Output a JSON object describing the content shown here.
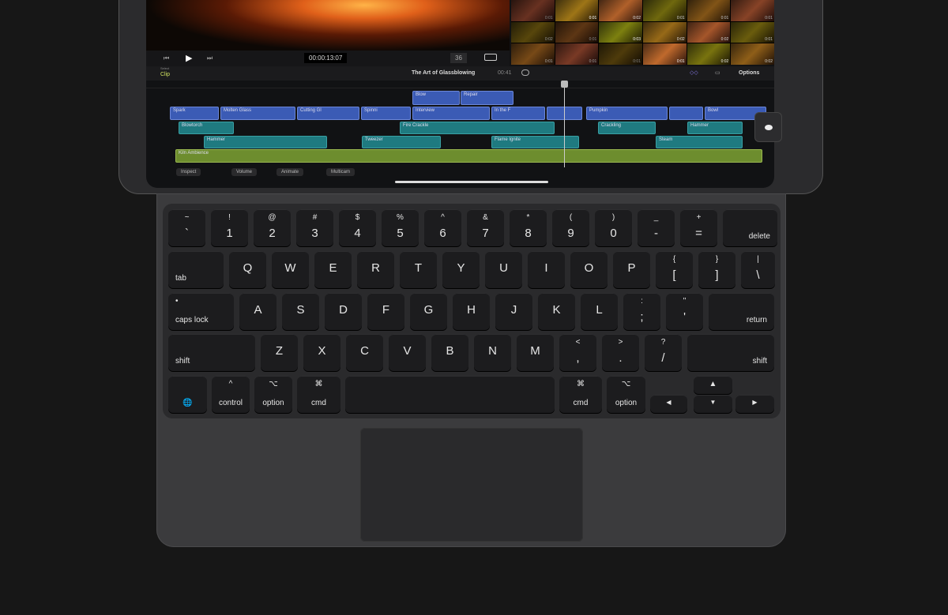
{
  "fcp": {
    "viewer": {
      "skip_back": "⏮",
      "play": "▶",
      "skip_fwd": "⏭",
      "timecode": "00:00:13:07",
      "zoom": "36"
    },
    "browser": {
      "durations": [
        "0:01",
        "0:01",
        "0:02",
        "0:01",
        "0:01",
        "0:01",
        "0:02",
        "0:01",
        "0:03",
        "0:02",
        "0:02",
        "0:01",
        "0:01",
        "0:01",
        "0:01",
        "0:01",
        "0:02",
        "0:02"
      ]
    },
    "header": {
      "select_label": "Select",
      "mode": "Clip",
      "project_title": "The Art of Glassblowing",
      "duration": "00:41",
      "options": "Options"
    },
    "clips": {
      "connected_video": [
        "Blow",
        "Repair"
      ],
      "primary": [
        "Spark",
        "Molten Glass",
        "Cutting Gl",
        "Spinni",
        "Interview",
        "In the F",
        "",
        "Pumpkin",
        "",
        "Bowl"
      ],
      "audio1": [
        "Blowtorch",
        "Fire Crackle",
        "Crackling",
        "Hammer"
      ],
      "audio2": [
        "Hammer",
        "Tweezer",
        "Flame Ignite",
        "Steam"
      ],
      "music": "Kiln Ambience"
    },
    "toolbar": [
      "Inspect",
      "Volume",
      "Animate",
      "Multicam"
    ]
  },
  "keyboard": {
    "rows": [
      [
        [
          "~",
          "`"
        ],
        [
          "!",
          "1"
        ],
        [
          "@",
          "2"
        ],
        [
          "#",
          "3"
        ],
        [
          "$",
          "4"
        ],
        [
          "%",
          "5"
        ],
        [
          "^",
          "6"
        ],
        [
          "&",
          "7"
        ],
        [
          "*",
          "8"
        ],
        [
          "(",
          "9"
        ],
        [
          ")",
          "0"
        ],
        [
          "_",
          "-"
        ],
        [
          "+",
          "="
        ],
        [
          "",
          "delete"
        ]
      ],
      [
        [
          "",
          "tab"
        ],
        [
          "Q"
        ],
        [
          "W"
        ],
        [
          "E"
        ],
        [
          "R"
        ],
        [
          "T"
        ],
        [
          "Y"
        ],
        [
          "U"
        ],
        [
          "I"
        ],
        [
          "O"
        ],
        [
          "P"
        ],
        [
          "{",
          "["
        ],
        [
          "}",
          "]"
        ],
        [
          "|",
          "\\"
        ]
      ],
      [
        [
          "•",
          "caps lock"
        ],
        [
          "A"
        ],
        [
          "S"
        ],
        [
          "D"
        ],
        [
          "F"
        ],
        [
          "G"
        ],
        [
          "H"
        ],
        [
          "J"
        ],
        [
          "K"
        ],
        [
          "L"
        ],
        [
          ":",
          ";"
        ],
        [
          "\"",
          "'"
        ],
        [
          "",
          "return"
        ]
      ],
      [
        [
          "",
          "shift"
        ],
        [
          "Z"
        ],
        [
          "X"
        ],
        [
          "C"
        ],
        [
          "V"
        ],
        [
          "B"
        ],
        [
          "N"
        ],
        [
          "M"
        ],
        [
          "<",
          ","
        ],
        [
          ">",
          "."
        ],
        [
          "?",
          "/"
        ],
        [
          "",
          "shift"
        ]
      ],
      [
        [
          "",
          "🌐"
        ],
        [
          "^",
          "control"
        ],
        [
          "⌥",
          "option"
        ],
        [
          "⌘",
          "cmd"
        ],
        [
          "",
          ""
        ],
        [
          "⌘",
          "cmd"
        ],
        [
          "⌥",
          "option"
        ],
        [
          "",
          "◀"
        ],
        [
          "▲",
          ""
        ],
        [
          "",
          "▼"
        ],
        [
          "",
          "▶"
        ]
      ]
    ]
  }
}
